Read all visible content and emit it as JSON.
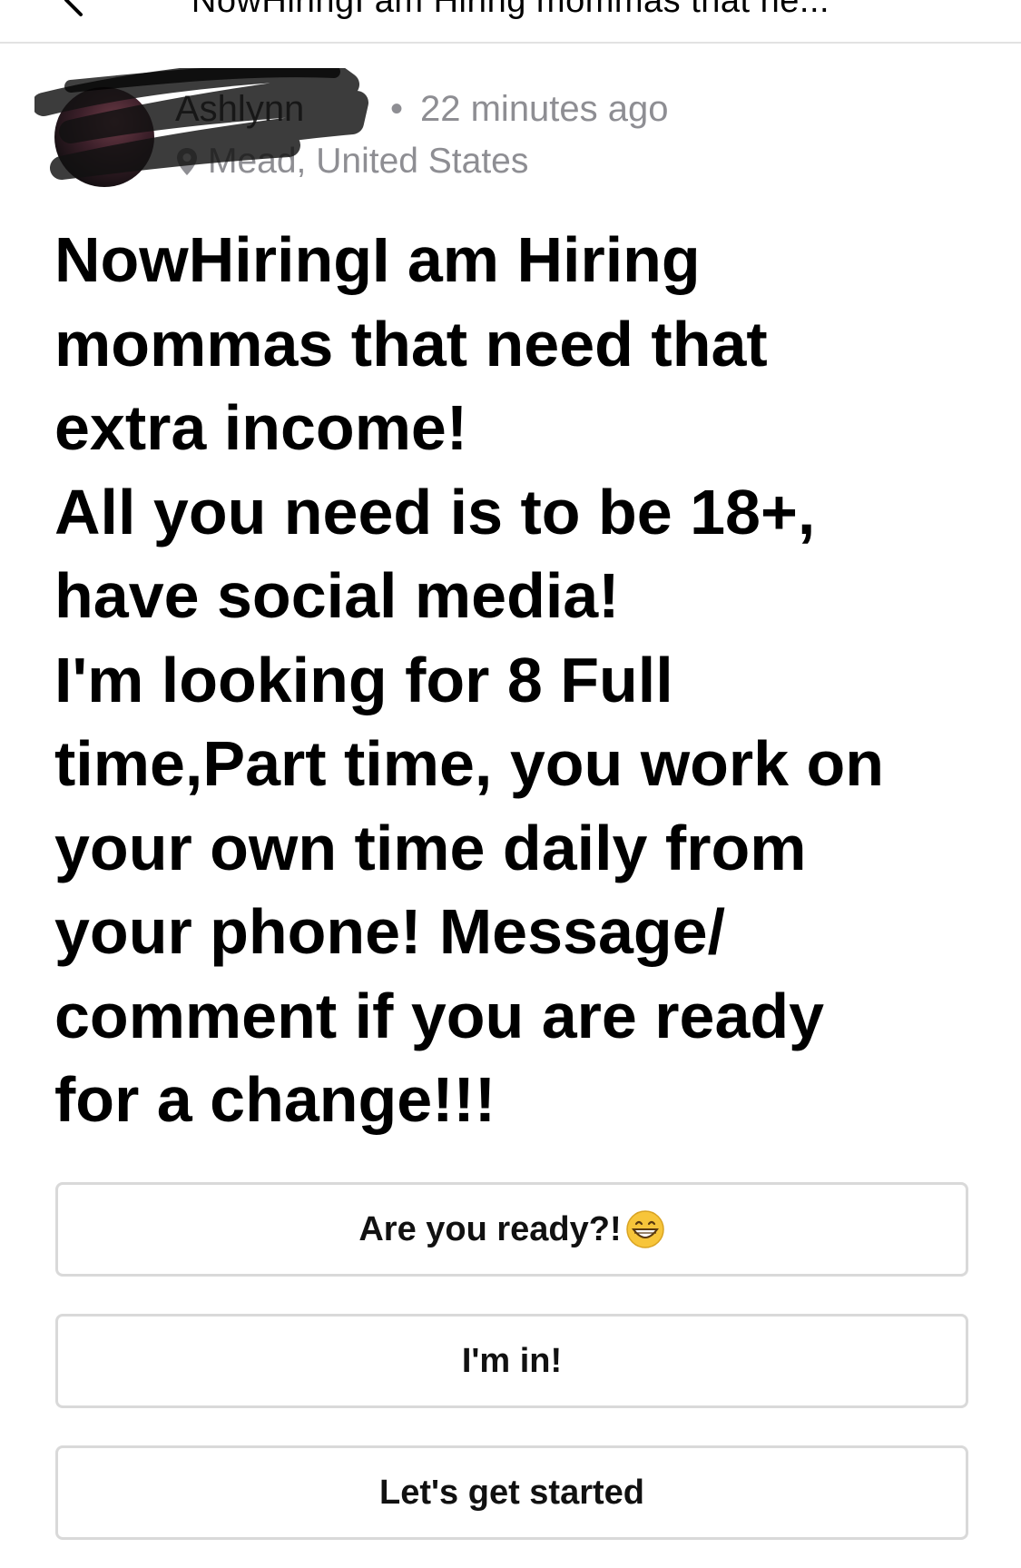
{
  "header": {
    "title": "NowHiringI am Hiring mommas that ne...",
    "back_icon": "chevron-left-icon"
  },
  "author": {
    "name": "Ashlynn",
    "separator": "•",
    "time": "22 minutes ago",
    "location": "Mead, United States",
    "location_icon": "map-pin-icon"
  },
  "post": {
    "body": "NowHiringI am Hiring\nmommas that need that\nextra income!\nAll you need is to be 18+,\nhave social media!\nI'm looking for 8 Full\ntime,Part time, you work on\nyour own time daily from\nyour phone! Message/\ncomment if you are ready\nfor a change!!!"
  },
  "options": [
    {
      "label": "Are you ready?!",
      "emoji": "grinning-face-icon"
    },
    {
      "label": "I'm in!"
    },
    {
      "label": "Let's get started"
    }
  ],
  "colors": {
    "meta_gray": "#8e8e93",
    "border_gray": "#d9d9d9",
    "emoji_yellow": "#f7c53a"
  }
}
